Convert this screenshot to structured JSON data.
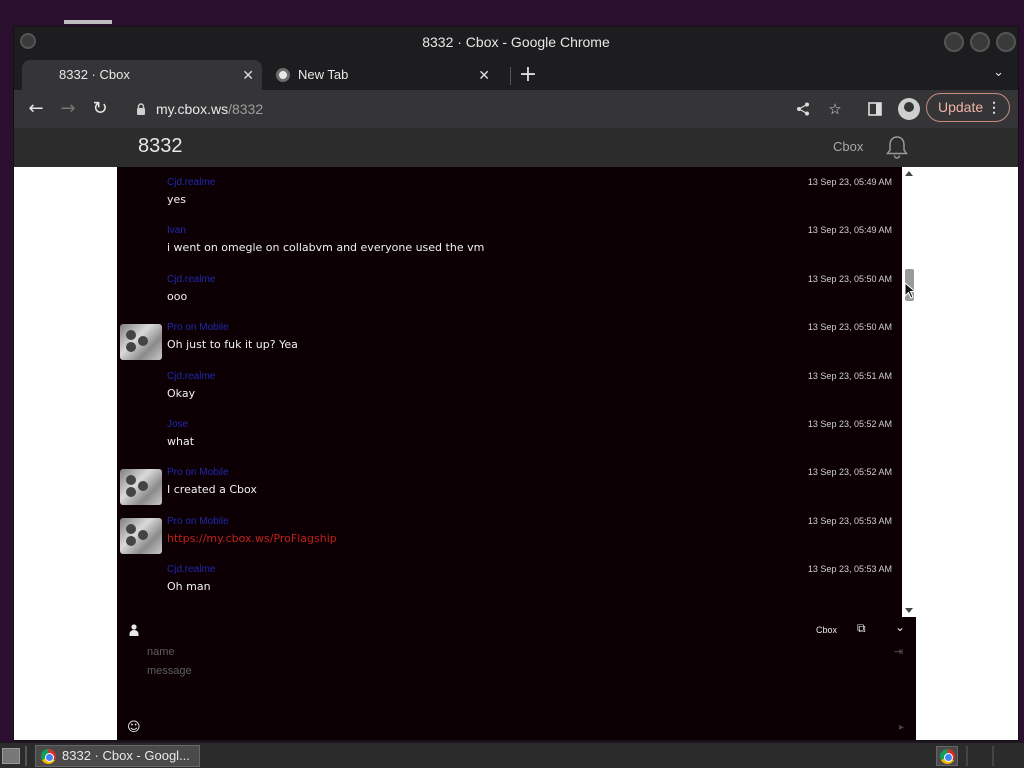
{
  "window": {
    "title": "8332 · Cbox - Google Chrome"
  },
  "tabs": [
    {
      "label": "8332 · Cbox",
      "active": true
    },
    {
      "label": "New Tab",
      "active": false
    }
  ],
  "toolbar": {
    "url_host": "my.cbox.ws",
    "url_path": "/8332",
    "update_label": "Update"
  },
  "site": {
    "title": "8332",
    "nav_cbox": "Cbox"
  },
  "messages": [
    {
      "author": "Cjd.realme",
      "time": "13 Sep 23, 05:49 AM",
      "text": "yes",
      "avatar": false,
      "link": false
    },
    {
      "author": "Ivan",
      "time": "13 Sep 23, 05:49 AM",
      "text": "i went on omegle on collabvm and everyone used the vm",
      "avatar": false,
      "link": false
    },
    {
      "author": "Cjd.realme",
      "time": "13 Sep 23, 05:50 AM",
      "text": "ooo",
      "avatar": false,
      "link": false
    },
    {
      "author": "Pro on Mobile",
      "time": "13 Sep 23, 05:50 AM",
      "text": "Oh just to fuk it up? Yea",
      "avatar": true,
      "link": false
    },
    {
      "author": "Cjd.realme",
      "time": "13 Sep 23, 05:51 AM",
      "text": "Okay",
      "avatar": false,
      "link": false
    },
    {
      "author": "Jose",
      "time": "13 Sep 23, 05:52 AM",
      "text": "what",
      "avatar": false,
      "link": false
    },
    {
      "author": "Pro on Mobile",
      "time": "13 Sep 23, 05:52 AM",
      "text": "I created a Cbox",
      "avatar": true,
      "link": false
    },
    {
      "author": "Pro on Mobile",
      "time": "13 Sep 23, 05:53 AM",
      "text": "https://my.cbox.ws/ProFlagship",
      "avatar": true,
      "link": true
    },
    {
      "author": "Cjd.realme",
      "time": "13 Sep 23, 05:53 AM",
      "text": "Oh man",
      "avatar": false,
      "link": false
    }
  ],
  "compose": {
    "cbox_label": "Cbox",
    "name_placeholder": "name",
    "message_placeholder": "message"
  },
  "taskbar": {
    "task_label": "8332 · Cbox - Googl..."
  },
  "colors": {
    "chat_bg": "#0c0004",
    "author": "#2127ad",
    "link": "#c0201a",
    "update_accent": "#f0b4a6"
  },
  "icons": {
    "back": "arrow-left-icon",
    "forward": "arrow-right-icon",
    "reload": "reload-icon",
    "share": "share-icon",
    "bookmark": "star-icon",
    "sidepanel": "side-panel-icon",
    "profile": "profile-icon",
    "bell": "bell-icon",
    "user": "user-icon",
    "external": "external-link-icon",
    "collapse": "collapse-icon",
    "emoji": "emoji-icon"
  }
}
